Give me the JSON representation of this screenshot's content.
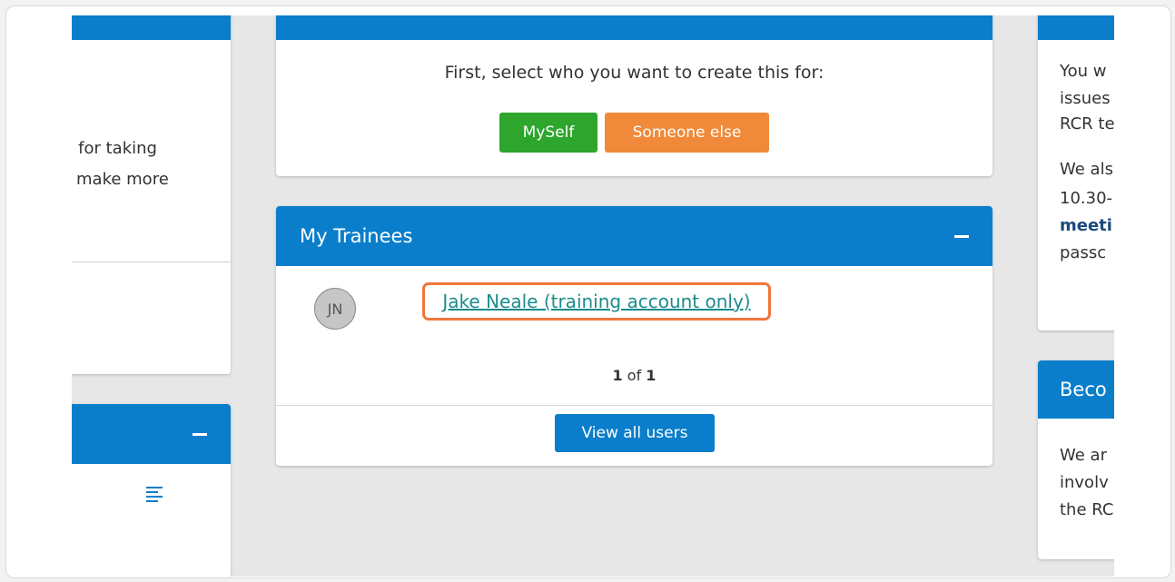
{
  "left_card": {
    "text_line1": "u for taking",
    "text_line2": "make more"
  },
  "create": {
    "prompt": "First, select who you want to create this for:",
    "myself_label": "MySelf",
    "someone_else_label": "Someone else"
  },
  "trainees": {
    "title": "My Trainees",
    "initials": "JN",
    "trainee_name": "Jake Neale (training account only)",
    "page_current": "1",
    "page_of": "of",
    "page_total": "1",
    "view_all_label": "View all users"
  },
  "right_card": {
    "lines": [
      "You w",
      "issues",
      "RCR te",
      "",
      "We als",
      "10.30-",
      "meeti",
      "passc"
    ]
  },
  "become_card": {
    "title": "Beco",
    "lines": [
      "We ar",
      "involv",
      "the RC"
    ]
  },
  "colors": {
    "header_blue": "#0a7ecb",
    "myself_green": "#2ea52d",
    "someone_orange": "#f08a3a",
    "highlight_orange": "#f0763c",
    "link_teal": "#1c8c8c"
  }
}
